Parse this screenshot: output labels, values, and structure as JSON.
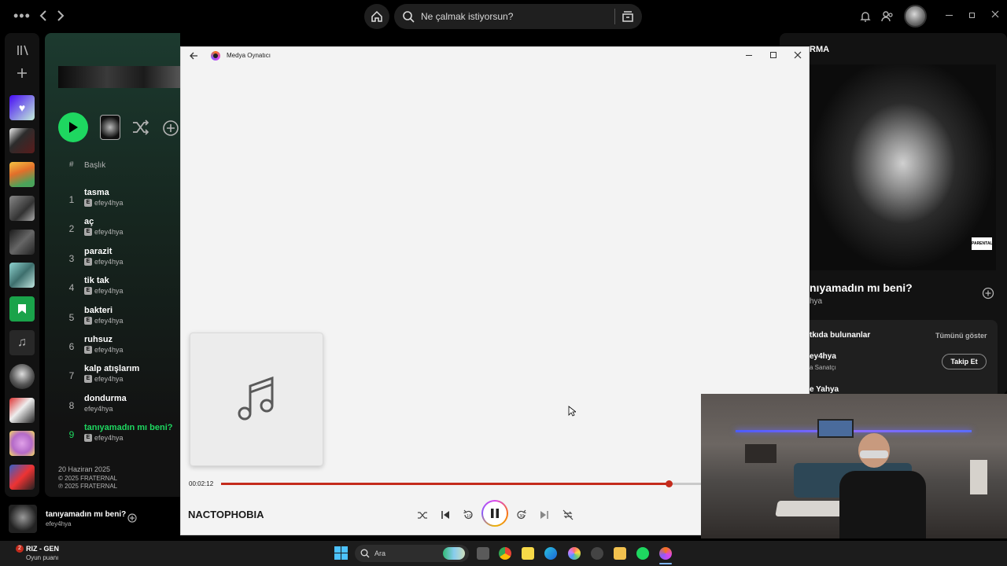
{
  "spotify": {
    "search_placeholder": "Ne çalmak istiyorsun?",
    "col_number": "#",
    "col_title": "Başlık",
    "tracks": [
      {
        "num": "1",
        "title": "tasma",
        "artist": "efey4hya",
        "explicit": "E"
      },
      {
        "num": "2",
        "title": "aç",
        "artist": "efey4hya",
        "explicit": "E"
      },
      {
        "num": "3",
        "title": "parazit",
        "artist": "efey4hya",
        "explicit": "E"
      },
      {
        "num": "4",
        "title": "tik tak",
        "artist": "efey4hya",
        "explicit": "E"
      },
      {
        "num": "5",
        "title": "bakteri",
        "artist": "efey4hya",
        "explicit": "E"
      },
      {
        "num": "6",
        "title": "ruhsuz",
        "artist": "efey4hya",
        "explicit": "E"
      },
      {
        "num": "7",
        "title": "kalp atışlarım",
        "artist": "efey4hya",
        "explicit": "E"
      },
      {
        "num": "8",
        "title": "dondurma",
        "artist": "efey4hya",
        "explicit": ""
      },
      {
        "num": "9",
        "title": "tanıyamadın mı beni?",
        "artist": "efey4hya",
        "explicit": "E"
      }
    ],
    "release_date": "20 Haziran 2025",
    "copyright_c": "© 2025 FRATERNAL",
    "copyright_p": "℗ 2025 FRATERNAL",
    "now_playing": {
      "title": "tanıyamadın mı beni?",
      "artist": "efey4hya"
    },
    "right_panel": {
      "header": "RMA",
      "song_title": "nıyamadın mı beni?",
      "song_artist": "hya",
      "related_title": "tkıda bulunanlar",
      "show_all": "Tümünü göster",
      "artist1": "ey4hya",
      "artist1_role": "a Sanatçı",
      "follow": "Takip Et",
      "artist2": "e Yahya"
    },
    "accent": "#1ed760"
  },
  "player": {
    "app_title": "Medya Oynatıcı",
    "time_elapsed": "00:02:12",
    "progress_fraction": 0.93,
    "song_name": "NACTOPHOBIA",
    "accent": "#c42b1c"
  },
  "taskbar": {
    "notif_count": "2",
    "game_title": "RIZ - GEN",
    "game_subtitle": "Oyun puanı",
    "search_placeholder": "Ara"
  }
}
